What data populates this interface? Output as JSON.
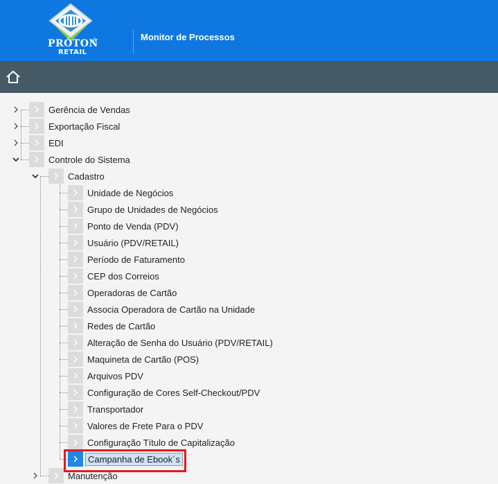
{
  "header": {
    "brand_line1": "PRÓTON",
    "brand_line2": "RETAIL",
    "brand_mark": "®",
    "title": "Monitor de Processos",
    "background": "#0f78e0"
  },
  "toolbar": {
    "home_icon": "home-icon",
    "background": "#455a64"
  },
  "tree": {
    "roots": [
      {
        "label": "Gerência de Vendas",
        "expanded": false
      },
      {
        "label": "Exportação Fiscal",
        "expanded": false
      },
      {
        "label": "EDI",
        "expanded": false
      },
      {
        "label": "Controle do Sistema",
        "expanded": true
      }
    ],
    "cadastro": {
      "label": "Cadastro",
      "expanded": true
    },
    "cadastro_items": [
      "Unidade de Negócios",
      "Grupo de Unidades de Negócios",
      "Ponto de Venda (PDV)",
      "Usuário (PDV/RETAIL)",
      "Período de Faturamento",
      "CEP dos Correios",
      "Operadoras de Cartão",
      "Associa Operadora de Cartão na Unidade",
      "Redes de Cartão",
      "Alteração de Senha do Usuário (PDV/RETAIL)",
      "Maquineta de Cartão (POS)",
      "Arquivos PDV",
      "Configuração de Cores Self-Checkout/PDV",
      "Transportador",
      "Valores de Frete Para o PDV",
      "Configuração Título de Capitalização"
    ],
    "selected_item": "Campanha de Ebook´s",
    "manutencao": {
      "label": "Manutenção",
      "expanded": false
    }
  },
  "highlight_color": "#e01b24"
}
